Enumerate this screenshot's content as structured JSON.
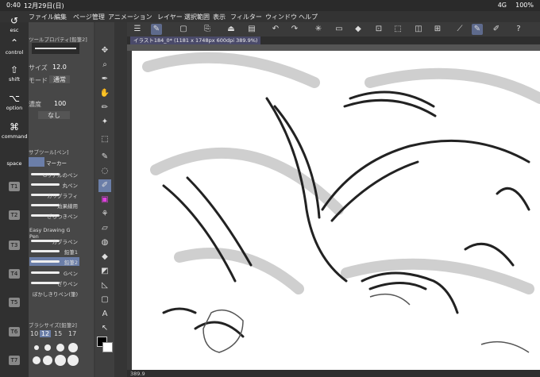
{
  "status": {
    "time": "0:40",
    "date": "12月29日(日)",
    "signal": "4G",
    "battery": "100%"
  },
  "menu": [
    "ファイル",
    "編集",
    "ページ管理",
    "アニメーション",
    "レイヤー",
    "選択範囲",
    "表示",
    "フィルター",
    "ウィンドウ",
    "ヘルプ"
  ],
  "tool_property": {
    "title": "ツールプロパティ[鉛筆2]",
    "size_label": "サイズ",
    "size_value": "12.0",
    "blend_label": "モード",
    "blend_value": "通常",
    "opacity_label": "濃度",
    "opacity_value": "100",
    "none_label": "なし"
  },
  "subtool": {
    "title": "サブツール[ペン]",
    "tabs": [
      "マーカー"
    ],
    "brushes": [
      "Gリアルのペン",
      "丸ペン",
      "カリグラフィ",
      "効果線用",
      "ざらつきペン",
      "Easy Drawing G Pen",
      "カブラペン",
      "鉛筆1",
      "鉛筆2",
      "Gペン",
      "ざりペン",
      "ぼかしきりペン(筆)"
    ],
    "selected_index": 8
  },
  "brush_size": {
    "title": "ブラシサイズ[鉛筆2]",
    "values": [
      "10",
      "12",
      "15",
      "17"
    ]
  },
  "keyboard": [
    "esc",
    "control",
    "shift",
    "option",
    "command",
    "space",
    "T1",
    "T2",
    "T3",
    "T4",
    "T5",
    "T6",
    "T7"
  ],
  "canvas": {
    "tab_title": "イラスト184_0* (1181 x 1748px 600dpi 389.9%)",
    "zoom": "389.9"
  },
  "colors": {
    "accent": "#6b7ea8",
    "canvas_bg": "#ffffff"
  }
}
